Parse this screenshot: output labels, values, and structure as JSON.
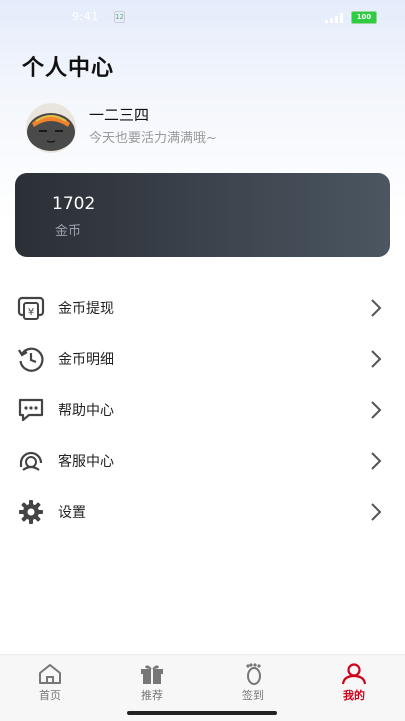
{
  "status_bar": {
    "time": "9:41",
    "sim": "12",
    "battery": "100"
  },
  "header": {
    "title": "个人中心"
  },
  "profile": {
    "username": "一二三四",
    "slogan": "今天也要活力满满哦~"
  },
  "coin_card": {
    "value": "1702",
    "label": "金币"
  },
  "menu": [
    {
      "label": "金币提现",
      "icon": "wallet-yuan-icon"
    },
    {
      "label": "金币明细",
      "icon": "history-icon"
    },
    {
      "label": "帮助中心",
      "icon": "chat-help-icon"
    },
    {
      "label": "客服中心",
      "icon": "headset-icon"
    },
    {
      "label": "设置",
      "icon": "gear-icon"
    }
  ],
  "tabs": [
    {
      "label": "首页",
      "icon": "home-icon",
      "active": false
    },
    {
      "label": "推荐",
      "icon": "gift-icon",
      "active": false
    },
    {
      "label": "签到",
      "icon": "footprint-icon",
      "active": false
    },
    {
      "label": "我的",
      "icon": "user-icon",
      "active": true
    }
  ],
  "colors": {
    "accent": "#d0021b",
    "card_dark": "#2b2f36",
    "card_light": "#4b5661"
  }
}
